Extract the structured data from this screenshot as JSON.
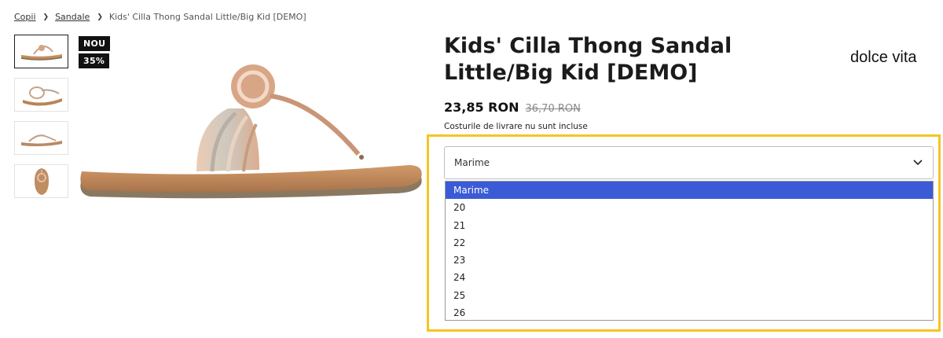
{
  "breadcrumb": {
    "items": [
      "Copii",
      "Sandale"
    ],
    "current": "Kids' Cilla Thong Sandal Little/Big Kid [DEMO]"
  },
  "badges": {
    "new": "NOU",
    "discount": "35%"
  },
  "product": {
    "title": "Kids' Cilla Thong Sandal Little/Big Kid [DEMO]",
    "brand": "dolce vita",
    "price_now": "23,85 RON",
    "price_old": "36,70 RON",
    "shipping_note": "Costurile de livrare nu sunt incluse"
  },
  "size_select": {
    "value": "Marime",
    "options": [
      "Marime",
      "20",
      "21",
      "22",
      "23",
      "24",
      "25",
      "26"
    ],
    "selected_index": 0
  },
  "colors": {
    "accent_highlight": "#f5c523",
    "option_selected": "#3b5bd6",
    "badge_bg": "#111111"
  }
}
